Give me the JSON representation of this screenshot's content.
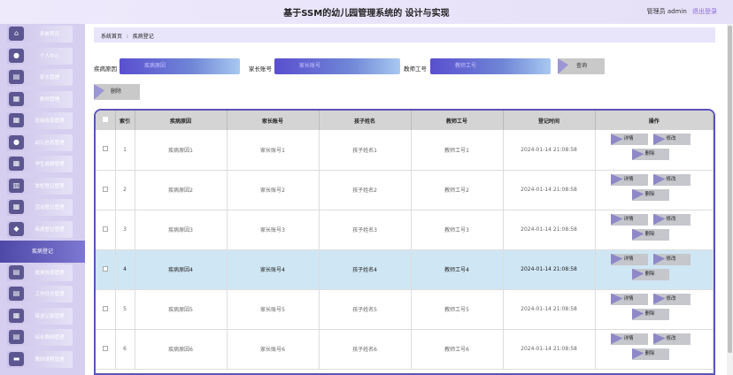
{
  "header": {
    "title": "基于SSM的幼儿园管理系统的 设计与实现",
    "user_label": "管理员 admin",
    "logout": "退出登录"
  },
  "sidebar": {
    "items": [
      {
        "label": "系统首页",
        "icon": "home-icon"
      },
      {
        "label": "个人中心",
        "icon": "user-icon"
      },
      {
        "label": "家长管理",
        "icon": "doc-icon"
      },
      {
        "label": "教师管理",
        "icon": "grid-icon"
      },
      {
        "label": "班级信息管理",
        "icon": "grid-icon"
      },
      {
        "label": "幼儿信息管理",
        "icon": "user-icon"
      },
      {
        "label": "学生成绩管理",
        "icon": "grid-icon"
      },
      {
        "label": "体检登记管理",
        "icon": "chart-icon"
      },
      {
        "label": "活动登记管理",
        "icon": "grid-icon"
      },
      {
        "label": "疾病登记管理",
        "icon": "pin-icon"
      },
      {
        "label": "疾病登记",
        "icon": "",
        "active": true
      },
      {
        "label": "收费信息管理",
        "icon": "doc-icon"
      },
      {
        "label": "工作日志管理",
        "icon": "doc-icon"
      },
      {
        "label": "接送记录管理",
        "icon": "grid-icon"
      },
      {
        "label": "综合教研管理",
        "icon": "doc-icon"
      },
      {
        "label": "教研课程管理",
        "icon": "folder-icon"
      }
    ]
  },
  "breadcrumb": {
    "home": "系统首页",
    "sep": "⁝",
    "current": "疾病登记"
  },
  "search": {
    "reason_label": "疾病原因",
    "reason_placeholder": "疾病原因",
    "parent_label": "家长账号",
    "parent_placeholder": "家长账号",
    "teacher_label": "教师工号",
    "teacher_placeholder": "教师工号",
    "query_button": "查询",
    "delete_button": "删除"
  },
  "table": {
    "headers": [
      "",
      "索引",
      "疾病原因",
      "家长账号",
      "孩子姓名",
      "教师工号",
      "登记时间",
      "操作"
    ],
    "rows": [
      {
        "index": "1",
        "reason": "疾病原因1",
        "parent": "家长账号1",
        "child": "孩子姓名1",
        "teacher": "教师工号1",
        "time": "2024-01-14 21:08:58"
      },
      {
        "index": "2",
        "reason": "疾病原因2",
        "parent": "家长账号2",
        "child": "孩子姓名2",
        "teacher": "教师工号2",
        "time": "2024-01-14 21:08:58"
      },
      {
        "index": "3",
        "reason": "疾病原因3",
        "parent": "家长账号3",
        "child": "孩子姓名3",
        "teacher": "教师工号3",
        "time": "2024-01-14 21:08:58"
      },
      {
        "index": "4",
        "reason": "疾病原因4",
        "parent": "家长账号4",
        "child": "孩子姓名4",
        "teacher": "教师工号4",
        "time": "2024-01-14 21:08:58",
        "highlight": true
      },
      {
        "index": "5",
        "reason": "疾病原因5",
        "parent": "家长账号5",
        "child": "孩子姓名5",
        "teacher": "教师工号5",
        "time": "2024-01-14 21:08:58"
      },
      {
        "index": "6",
        "reason": "疾病原因6",
        "parent": "家长账号6",
        "child": "孩子姓名6",
        "teacher": "教师工号6",
        "time": "2024-01-14 21:08:58"
      }
    ],
    "ops": {
      "detail": "详情",
      "edit": "修改",
      "delete": "删除"
    }
  },
  "colors": {
    "accent": "#5a55b8",
    "highlight_row": "#cfe6f4",
    "sidebar": "#d6cff0"
  }
}
